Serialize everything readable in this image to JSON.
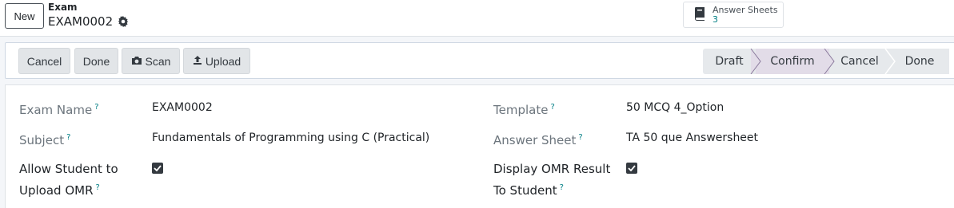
{
  "header": {
    "new_button": "New",
    "breadcrumb_parent": "Exam",
    "breadcrumb_current": "EXAM0002",
    "smart_button": {
      "label": "Answer Sheets",
      "count": "3"
    }
  },
  "actions": {
    "cancel": "Cancel",
    "done": "Done",
    "scan": "Scan",
    "upload": "Upload"
  },
  "stages": [
    {
      "label": "Draft",
      "active": false
    },
    {
      "label": "Confirm",
      "active": true
    },
    {
      "label": "Cancel",
      "active": false
    },
    {
      "label": "Done",
      "active": false
    }
  ],
  "form": {
    "exam_name": {
      "label": "Exam Name",
      "value": "EXAM0002"
    },
    "subject": {
      "label": "Subject",
      "value": "Fundamentals of Programming using C (Practical)"
    },
    "allow_upload": {
      "label_line1": "Allow Student to",
      "label_line2": "Upload OMR",
      "checked": true
    },
    "template": {
      "label": "Template",
      "value": "50 MCQ 4_Option"
    },
    "answer_sheet": {
      "label": "Answer Sheet",
      "value": "TA 50 que Answersheet"
    },
    "display_result": {
      "label_line1": "Display OMR Result",
      "label_line2": "To Student",
      "checked": true
    },
    "help_mark": "?"
  },
  "colors": {
    "accent": "#017e84",
    "active_stage": "#e2dce8"
  }
}
